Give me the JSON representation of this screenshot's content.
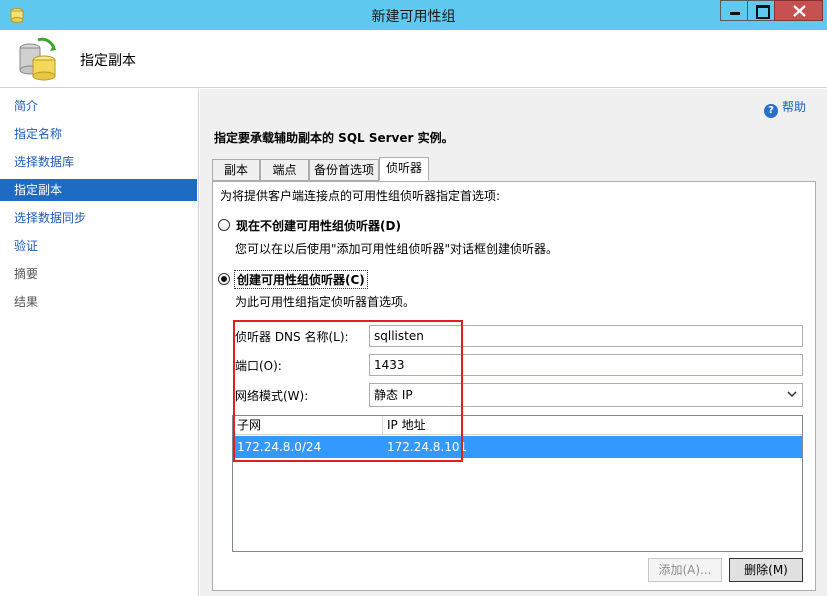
{
  "window": {
    "title": "新建可用性组"
  },
  "header": {
    "title": "指定副本",
    "icon": "database-replica-icon"
  },
  "nav": {
    "items": [
      {
        "label": "简介",
        "state": "link"
      },
      {
        "label": "指定名称",
        "state": "link"
      },
      {
        "label": "选择数据库",
        "state": "link"
      },
      {
        "label": "指定副本",
        "state": "selected"
      },
      {
        "label": "选择数据同步",
        "state": "link"
      },
      {
        "label": "验证",
        "state": "link"
      },
      {
        "label": "摘要",
        "state": "disabled"
      },
      {
        "label": "结果",
        "state": "disabled"
      }
    ]
  },
  "main": {
    "help_label": "帮助",
    "intro": "指定要承载辅助副本的 SQL Server 实例。",
    "tabs": [
      {
        "label": "副本",
        "active": false
      },
      {
        "label": "端点",
        "active": false
      },
      {
        "label": "备份首选项",
        "active": false
      },
      {
        "label": "侦听器",
        "active": true
      }
    ],
    "panel": {
      "description": "为将提供客户端连接点的可用性组侦听器指定首选项:",
      "option_none": {
        "label": "现在不创建可用性组侦听器(D)",
        "hint": "您可以在以后使用\"添加可用性组侦听器\"对话框创建侦听器。",
        "checked": false
      },
      "option_create": {
        "label": "创建可用性组侦听器(C)",
        "hint": "为此可用性组指定侦听器首选项。",
        "checked": true
      },
      "fields": {
        "dns_label": "侦听器 DNS 名称(L):",
        "dns_value": "sqllisten",
        "port_label": "端口(O):",
        "port_value": "1433",
        "mode_label": "网络模式(W):",
        "mode_value": "静态 IP"
      },
      "grid": {
        "columns": [
          "子网",
          "IP 地址"
        ],
        "rows": [
          {
            "subnet": "172.24.8.0/24",
            "ip": "172.24.8.101",
            "selected": true
          }
        ]
      },
      "buttons": {
        "add": "添加(A)...",
        "remove": "删除(M)"
      }
    }
  },
  "colors": {
    "titlebar": "#5fc9ef",
    "selection": "#1e6bc4",
    "grid_selection": "#3399ff",
    "highlight_box": "#e02020"
  }
}
